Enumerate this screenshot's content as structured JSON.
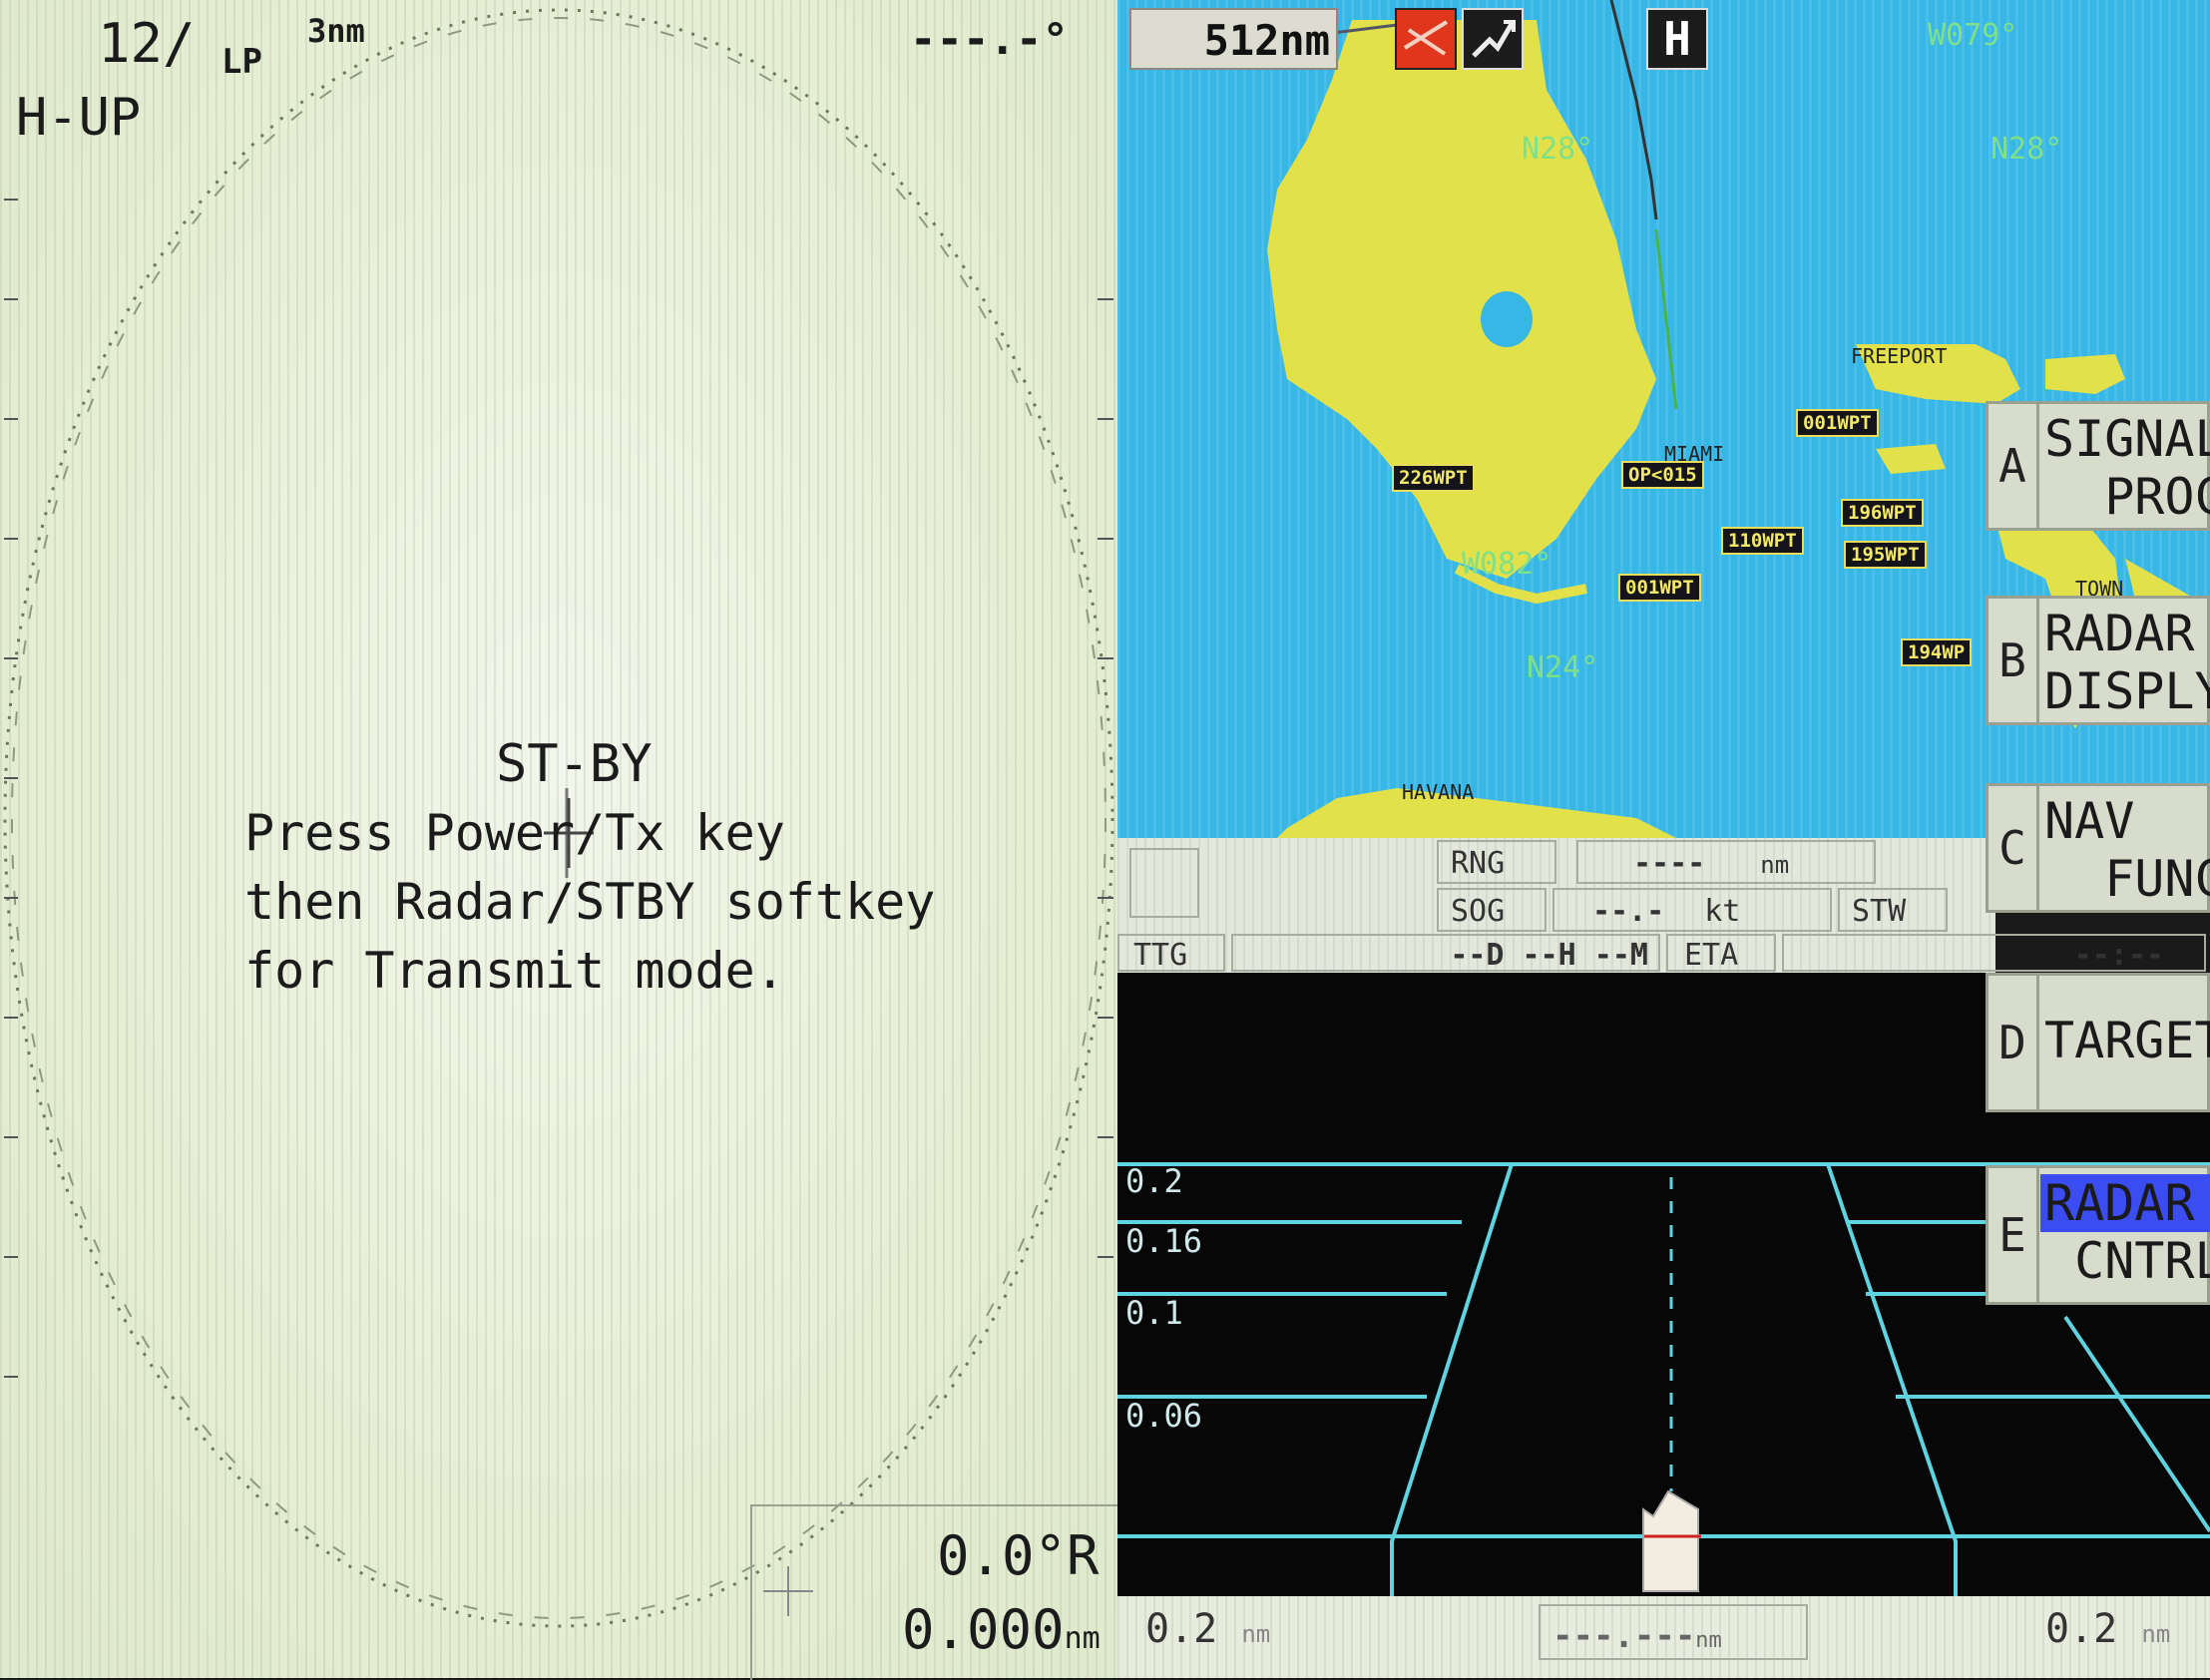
{
  "radar": {
    "range_scale": "12/",
    "pulse": "LP",
    "range_rings": "3nm",
    "orientation": "H-UP",
    "heading_readout": "---.-°",
    "status": "ST-BY",
    "message": [
      "Press Power/Tx key",
      "then Radar/STBY softkey",
      "for Transmit mode."
    ],
    "cursor_bearing": "0.0°R",
    "cursor_range_value": "0.000",
    "cursor_range_unit": "nm"
  },
  "chart": {
    "range": "512nm",
    "h_button": "H",
    "grid_labels": [
      "W079°",
      "N28°",
      "N28°",
      "W082°",
      "N24°"
    ],
    "places": [
      "FREEPORT",
      "MIAMI",
      "HAVANA",
      "TOWN"
    ],
    "waypoints": [
      "226WPT",
      "OP<015",
      "001WPT",
      "196WPT",
      "110WPT",
      "195WPT",
      "001WPT",
      "194WP"
    ]
  },
  "nav": {
    "rng_label": "RNG",
    "rng_value": "----",
    "rng_unit": "nm",
    "sog_label": "SOG",
    "sog_value": "--.-",
    "sog_unit": "kt",
    "stw_label": "STW",
    "ttg_label": "TTG",
    "ttg_value": "--D --H --M",
    "eta_label": "ETA",
    "eta_value": "--:--"
  },
  "highway": {
    "scale_labels": [
      "0.2",
      "0.16",
      "0.1",
      "0.06"
    ],
    "bottom_left_value": "0.2",
    "bottom_left_unit": "nm",
    "bottom_center": "---.---",
    "bottom_center_unit": "nm",
    "bottom_right_value": "0.2",
    "bottom_right_unit": "nm"
  },
  "softkeys": [
    {
      "key": "A",
      "label": "SIGNAL\n  PROC."
    },
    {
      "key": "B",
      "label": "RADAR\nDISPLY"
    },
    {
      "key": "C",
      "label": "NAV\n  FUNC"
    },
    {
      "key": "D",
      "label": "TARGET"
    },
    {
      "key": "E",
      "label": "RADAR\n CNTRL"
    }
  ],
  "colors": {
    "land": "#e2e14a",
    "sea": "#36b7e6",
    "highway_lines": "#5fd3e0",
    "highlight": "#3b4cf0"
  }
}
